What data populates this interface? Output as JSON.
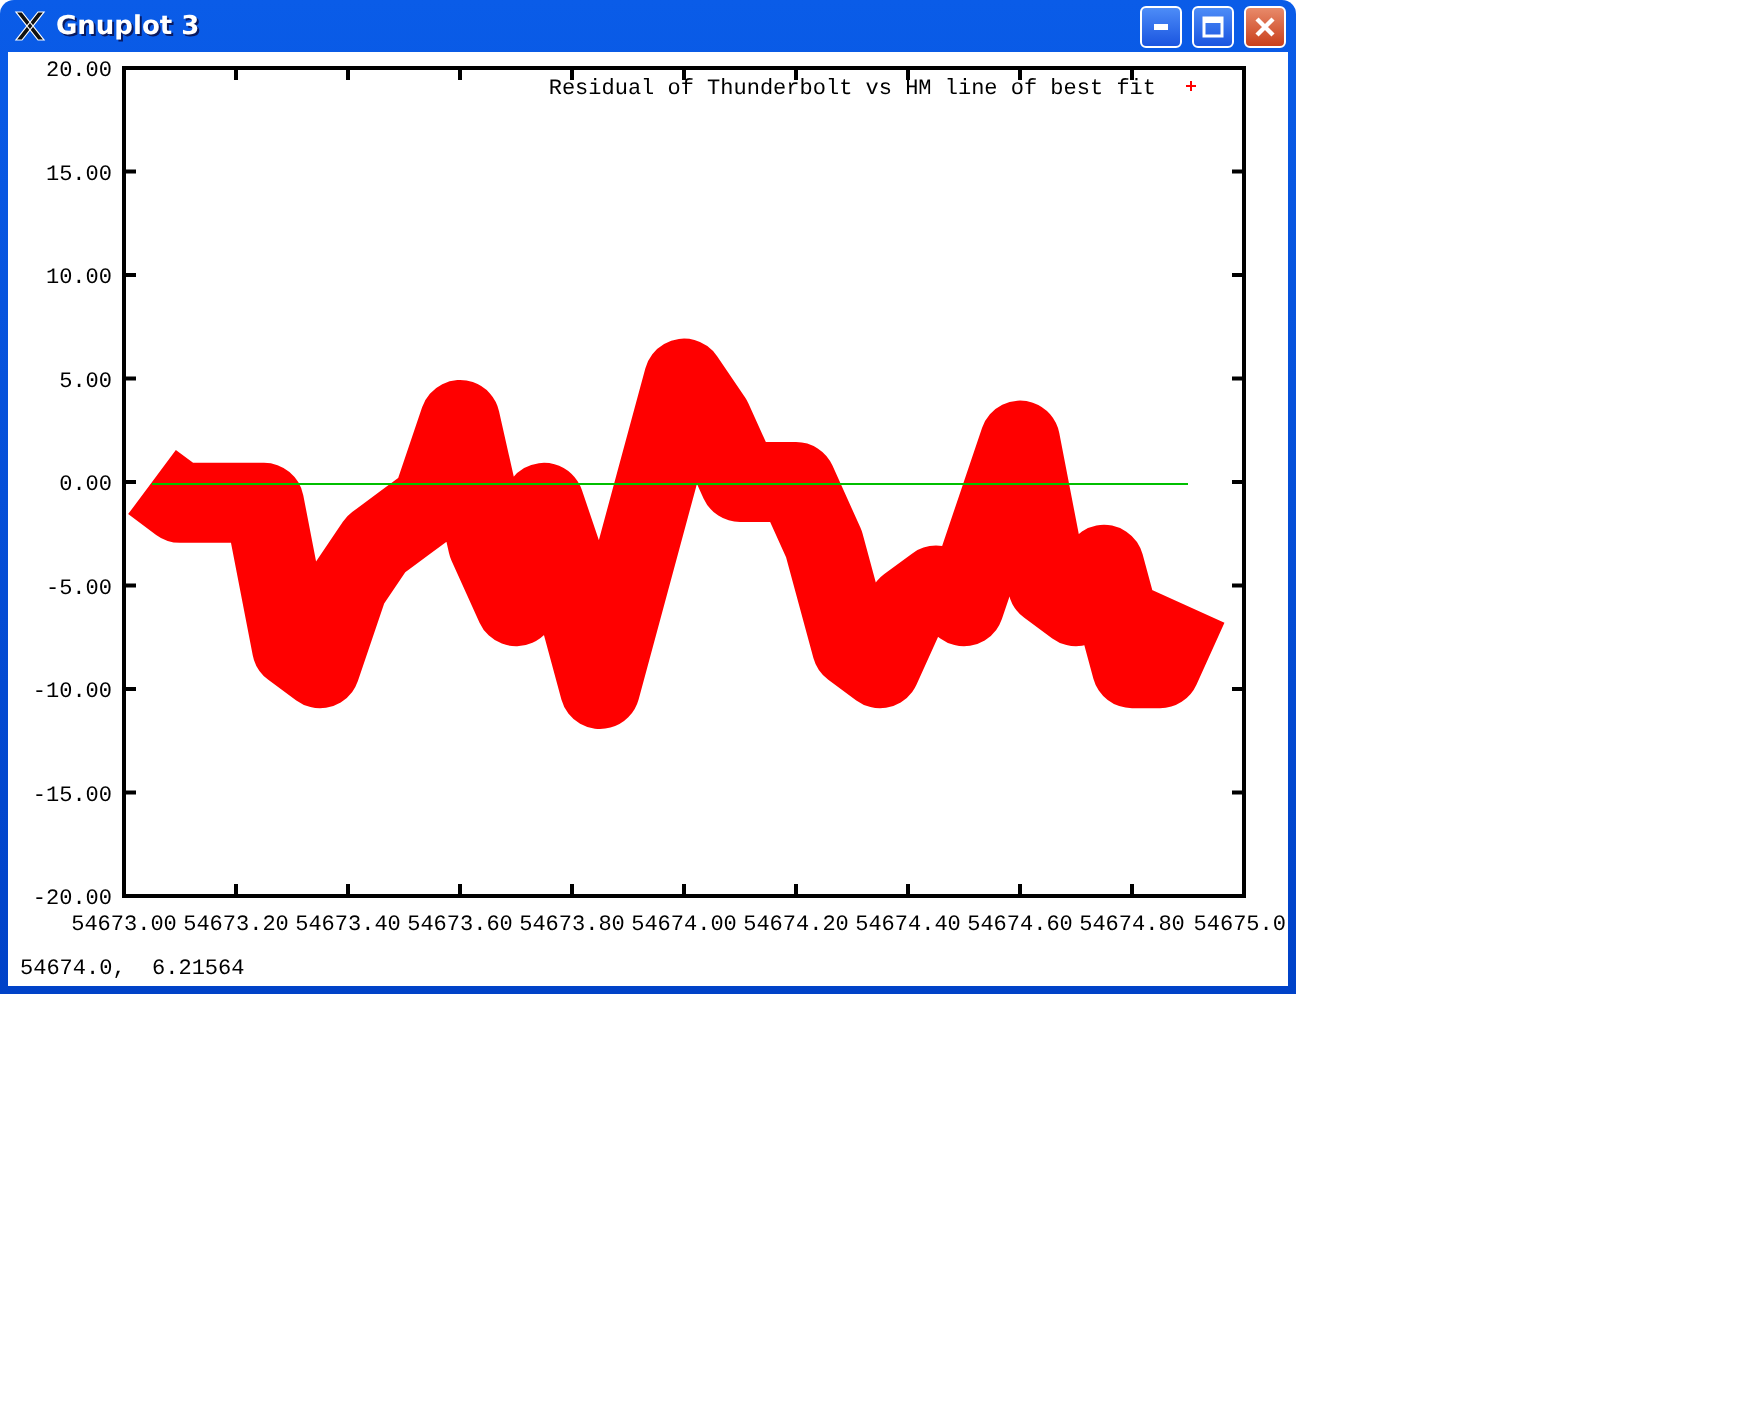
{
  "window": {
    "title": "Gnuplot 3"
  },
  "plot": {
    "chart_data": {
      "type": "line",
      "x": [
        54673.05,
        54673.1,
        54673.15,
        54673.2,
        54673.25,
        54673.3,
        54673.35,
        54673.4,
        54673.45,
        54673.5,
        54673.55,
        54673.6,
        54673.65,
        54673.7,
        54673.75,
        54673.8,
        54673.85,
        54673.9,
        54673.95,
        54674.0,
        54674.05,
        54674.1,
        54674.15,
        54674.2,
        54674.25,
        54674.3,
        54674.35,
        54674.4,
        54674.45,
        54674.5,
        54674.55,
        54674.6,
        54674.65,
        54674.7,
        54674.75,
        54674.8,
        54674.85,
        54674.9
      ],
      "series": [
        {
          "name": "Residual of Thunderbolt vs HM line of best fit",
          "color": "#ff0000",
          "values": [
            0,
            -1,
            -1,
            -1,
            -1,
            -8,
            -9,
            -5,
            -3,
            -2,
            -1,
            3,
            -3,
            -6,
            -1,
            -5,
            -10,
            -5,
            0,
            5,
            3,
            0,
            0,
            0,
            -3,
            -8,
            -9,
            -6,
            -5,
            -6,
            -2,
            2,
            -5,
            -6,
            -4,
            -9,
            -9,
            -6
          ]
        },
        {
          "color": "#00c000",
          "values": [
            -0.1,
            -0.1,
            -0.1,
            -0.1,
            -0.1,
            -0.1,
            -0.1,
            -0.1,
            -0.1,
            -0.1,
            -0.1,
            -0.1,
            -0.1,
            -0.1,
            -0.1,
            -0.1,
            -0.1,
            -0.1,
            -0.1,
            -0.1,
            -0.1,
            -0.1,
            -0.1,
            -0.1,
            -0.1,
            -0.1,
            -0.1,
            -0.1,
            -0.1,
            -0.1,
            -0.1,
            -0.1,
            -0.1,
            -0.1,
            -0.1,
            -0.1,
            -0.1,
            -0.1
          ]
        }
      ],
      "xlim": [
        54673.0,
        54675.0
      ],
      "ylim": [
        -20,
        20
      ],
      "xticks": [
        {
          "value": 54673.0,
          "label": "54673.00"
        },
        {
          "value": 54673.2,
          "label": "54673.20"
        },
        {
          "value": 54673.4,
          "label": "54673.40"
        },
        {
          "value": 54673.6,
          "label": "54673.60"
        },
        {
          "value": 54673.8,
          "label": "54673.80"
        },
        {
          "value": 54674.0,
          "label": "54674.00"
        },
        {
          "value": 54674.2,
          "label": "54674.20"
        },
        {
          "value": 54674.4,
          "label": "54674.40"
        },
        {
          "value": 54674.6,
          "label": "54674.60"
        },
        {
          "value": 54674.8,
          "label": "54674.80"
        },
        {
          "value": 54675.0,
          "label": "54675.0"
        }
      ],
      "yticks": [
        {
          "value": 20,
          "label": "20.00"
        },
        {
          "value": 15,
          "label": "15.00"
        },
        {
          "value": 10,
          "label": "10.00"
        },
        {
          "value": 5,
          "label": "5.00"
        },
        {
          "value": 0,
          "label": "0.00"
        },
        {
          "value": -5,
          "label": "-5.00"
        },
        {
          "value": -10,
          "label": "-10.00"
        },
        {
          "value": -15,
          "label": "-15.00"
        },
        {
          "value": -20,
          "label": "-20.00"
        }
      ]
    }
  },
  "status_bar": {
    "text": "54674.0,  6.21564"
  }
}
